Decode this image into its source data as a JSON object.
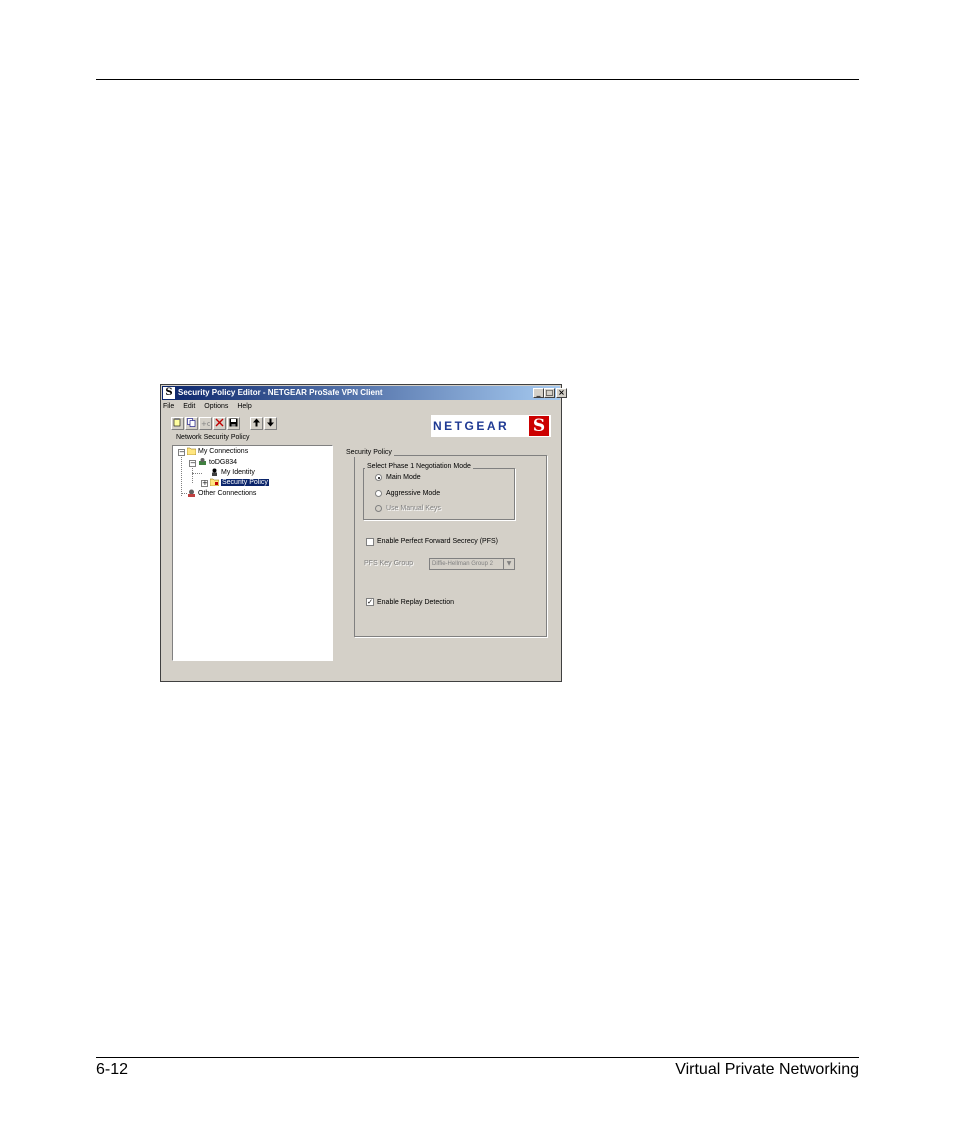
{
  "page": {
    "page_number": "6-12",
    "section_title": "Virtual Private Networking"
  },
  "window": {
    "title": "Security Policy Editor - NETGEAR ProSafe VPN Client",
    "app_icon_letter": "S",
    "menu": [
      "File",
      "Edit",
      "Options",
      "Help"
    ],
    "logo_text": "NETGEAR",
    "logo_mark": "S"
  },
  "tree": {
    "heading": "Network Security Policy",
    "items": [
      {
        "label": "My Connections",
        "expander": "−"
      },
      {
        "label": "toDG834",
        "expander": "−"
      },
      {
        "label": "My Identity"
      },
      {
        "label": "Security Policy",
        "expander": "+",
        "selected": true
      },
      {
        "label": "Other Connections"
      }
    ]
  },
  "security_policy": {
    "group_label": "Security Policy",
    "phase1_label": "Select Phase 1 Negotiation Mode",
    "modes": [
      {
        "label": "Main Mode",
        "selected": true,
        "enabled": true
      },
      {
        "label": "Aggressive Mode",
        "selected": false,
        "enabled": true
      },
      {
        "label": "Use Manual Keys",
        "selected": false,
        "enabled": false
      }
    ],
    "pfs": {
      "label": "Enable Perfect Forward Secrecy (PFS)",
      "checked": false
    },
    "pfs_key_group": {
      "label": "PFS Key Group",
      "value": "Diffie-Hellman Group 2",
      "enabled": false
    },
    "replay": {
      "label": "Enable Replay Detection",
      "checked": true,
      "check_glyph": "✓"
    }
  }
}
